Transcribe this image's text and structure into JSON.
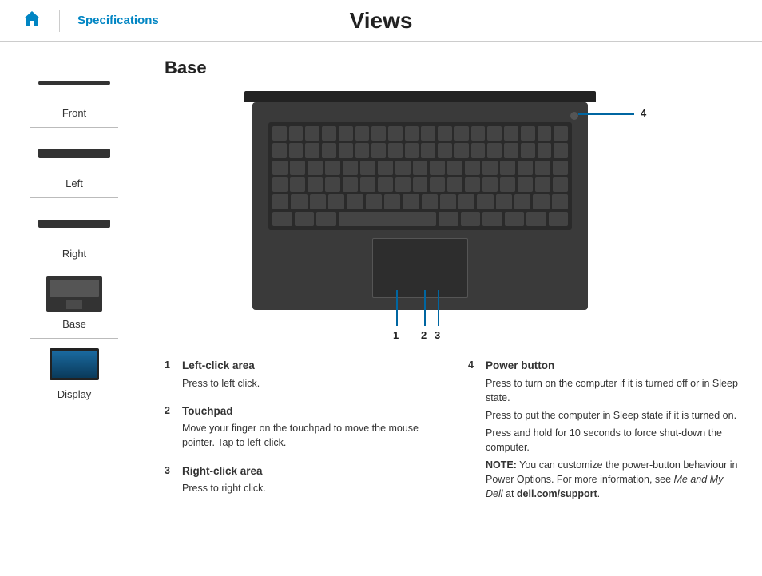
{
  "header": {
    "specifications": "Specifications",
    "title": "Views"
  },
  "sidebar": {
    "items": [
      {
        "label": "Front"
      },
      {
        "label": "Left"
      },
      {
        "label": "Right"
      },
      {
        "label": "Base"
      },
      {
        "label": "Display"
      }
    ]
  },
  "section": {
    "title": "Base"
  },
  "callouts": {
    "n1": "1",
    "n2": "2",
    "n3": "3",
    "n4": "4"
  },
  "features": {
    "left": [
      {
        "num": "1",
        "title": "Left-click area",
        "desc": "Press to left click."
      },
      {
        "num": "2",
        "title": "Touchpad",
        "desc": "Move your finger on the touchpad to move the mouse pointer. Tap to left-click."
      },
      {
        "num": "3",
        "title": "Right-click area",
        "desc": "Press to right click."
      }
    ],
    "right": [
      {
        "num": "4",
        "title": "Power button",
        "p1": "Press to turn on the computer if it is turned off or in Sleep state.",
        "p2": "Press to put the computer in Sleep state if it is turned on.",
        "p3": "Press and hold for 10 seconds to force shut-down the computer.",
        "note_label": "NOTE:",
        "note_text": " You can customize the power-button behaviour in Power Options. For more information, see ",
        "note_em": "Me and My Dell",
        "note_tail": " at ",
        "note_link": "dell.com/support",
        "note_end": "."
      }
    ]
  }
}
